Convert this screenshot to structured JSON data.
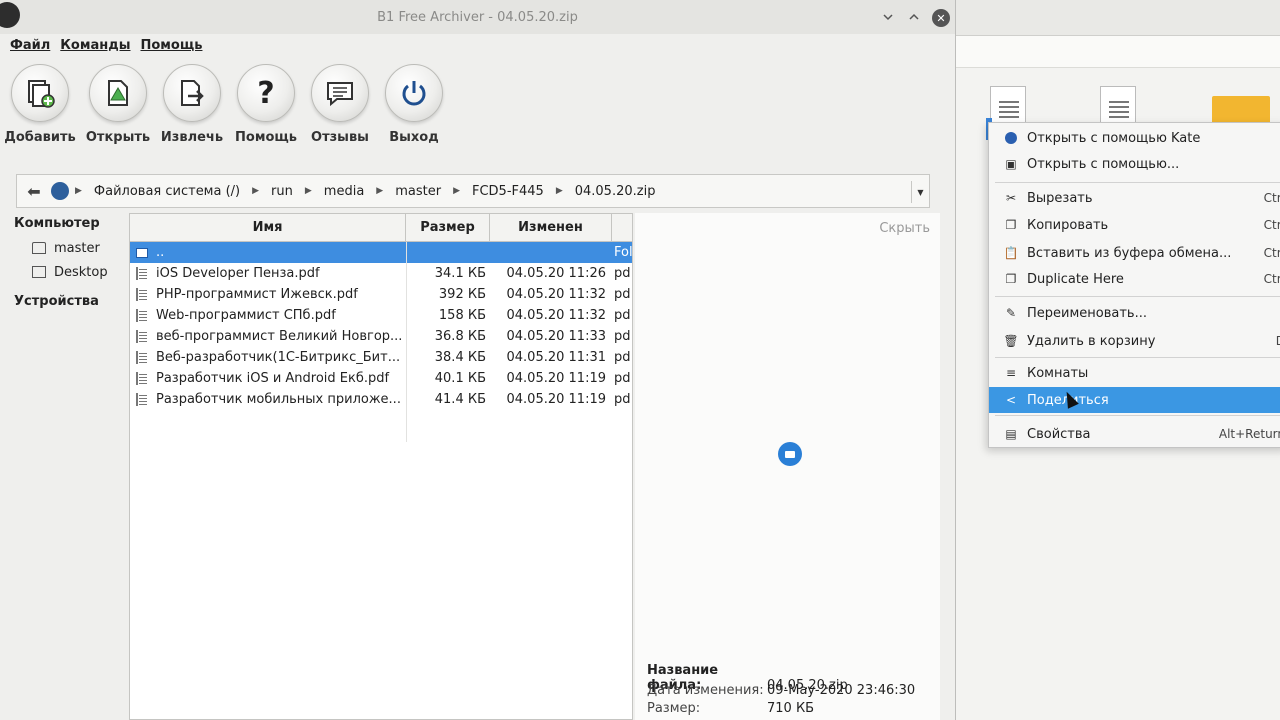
{
  "window": {
    "title": "B1 Free Archiver - 04.05.20.zip"
  },
  "menu": [
    "Файл",
    "Команды",
    "Помощь"
  ],
  "toolbar": [
    {
      "label": "Добавить",
      "icon": "add-archive-icon"
    },
    {
      "label": "Открыть",
      "icon": "open-archive-icon"
    },
    {
      "label": "Извлечь",
      "icon": "extract-icon"
    },
    {
      "label": "Помощь",
      "icon": "help-icon"
    },
    {
      "label": "Отзывы",
      "icon": "feedback-icon"
    },
    {
      "label": "Выход",
      "icon": "power-icon"
    }
  ],
  "path": [
    "Файловая система (/)",
    "run",
    "media",
    "master",
    "FCD5-F445",
    "04.05.20.zip"
  ],
  "sidebar": {
    "computer_header": "Компьютер",
    "items": [
      "master",
      "Desktop"
    ],
    "devices_header": "Устройства"
  },
  "columns": {
    "name": "Имя",
    "size": "Размер",
    "modified": "Изменен"
  },
  "files": [
    {
      "name": "..",
      "size": "",
      "date": "",
      "type": "Fol"
    },
    {
      "name": "iOS Developer Пенза.pdf",
      "size": "34.1 КБ",
      "date": "04.05.20 11:26",
      "type": "pd"
    },
    {
      "name": "PHP-программист Ижевск.pdf",
      "size": "392 КБ",
      "date": "04.05.20 11:32",
      "type": "pd"
    },
    {
      "name": "Web-программист СПб.pdf",
      "size": "158 КБ",
      "date": "04.05.20 11:32",
      "type": "pd"
    },
    {
      "name": "веб-программист Великий Новгор...",
      "size": "36.8 КБ",
      "date": "04.05.20 11:33",
      "type": "pd"
    },
    {
      "name": "Веб-разработчик(1С-Битрикс_Бит...",
      "size": "38.4 КБ",
      "date": "04.05.20 11:31",
      "type": "pd"
    },
    {
      "name": "Разработчик iOS и Android Екб.pdf",
      "size": "40.1 КБ",
      "date": "04.05.20 11:19",
      "type": "pd"
    },
    {
      "name": "Разработчик мобильных приложе...",
      "size": "41.4 КБ",
      "date": "04.05.20 11:19",
      "type": "pd"
    }
  ],
  "preview": {
    "hide_label": "Скрыть",
    "filename_label": "Название файла:",
    "filename_value": "04.05.20.zip",
    "modified_label": "Дата изменения:",
    "modified_value": "09-May-2020 23:46:30",
    "size_label": "Размер:",
    "size_value": "710 КБ"
  },
  "context_menu": [
    {
      "label": "Открыть с помощью Kate",
      "icon": "kate-icon",
      "shortcut": ""
    },
    {
      "label": "Открыть с помощью...",
      "icon": "open-with-icon",
      "shortcut": ""
    },
    {
      "label": "Вырезать",
      "icon": "cut-icon",
      "shortcut": "Ctrl"
    },
    {
      "label": "Копировать",
      "icon": "copy-icon",
      "shortcut": "Ctrl"
    },
    {
      "label": "Вставить из буфера обмена...",
      "icon": "paste-icon",
      "shortcut": "Ctrl"
    },
    {
      "label": "Duplicate Here",
      "icon": "duplicate-icon",
      "shortcut": "Ctrl"
    },
    {
      "label": "Переименовать...",
      "icon": "rename-icon",
      "shortcut": ""
    },
    {
      "label": "Удалить в корзину",
      "icon": "trash-icon",
      "shortcut": "D"
    },
    {
      "label": "Комнаты",
      "icon": "activities-icon",
      "shortcut": ""
    },
    {
      "label": "Поделиться",
      "icon": "share-icon",
      "shortcut": ""
    },
    {
      "label": "Свойства",
      "icon": "properties-icon",
      "shortcut": "Alt+Return"
    }
  ]
}
